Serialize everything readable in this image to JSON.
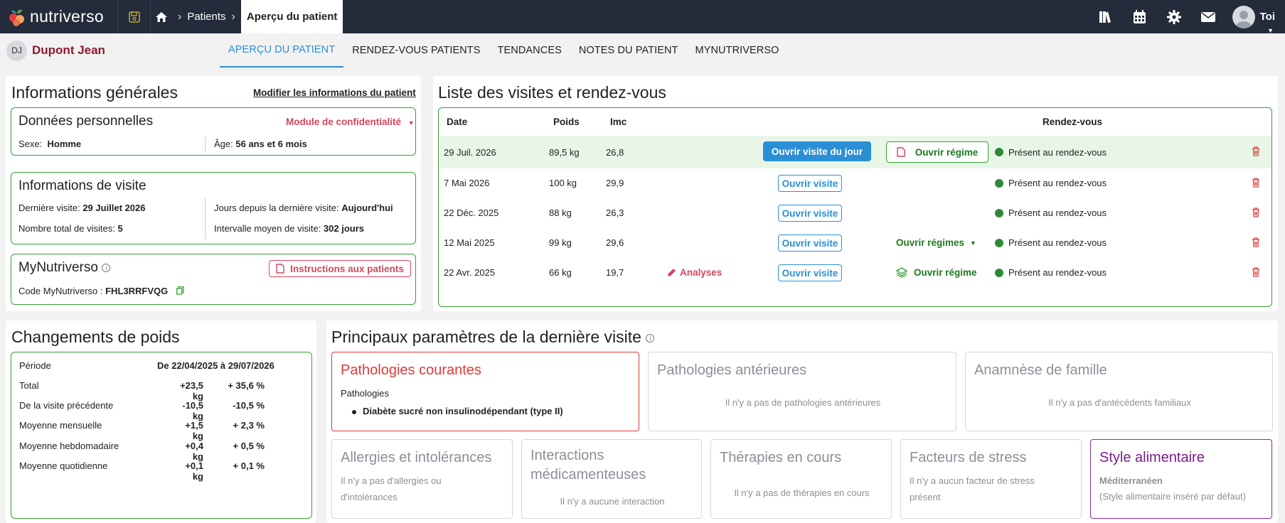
{
  "app": {
    "logo_text": "nutriverso",
    "brand_colors": {
      "topbar": "#242b3a",
      "accent": "#2b8fd5",
      "green": "#34a233",
      "pink": "#d6455e"
    }
  },
  "breadcrumb": {
    "items": [
      "Patients"
    ],
    "current": "Aperçu du patient"
  },
  "top_icons": [
    "library-icon",
    "calendar-icon",
    "gear-icon",
    "mail-icon"
  ],
  "user": {
    "label": "Toi"
  },
  "patient": {
    "initials": "DJ",
    "name": "Dupont Jean"
  },
  "tabs": [
    {
      "label": "APERÇU DU PATIENT",
      "active": true
    },
    {
      "label": "RENDEZ-VOUS PATIENTS"
    },
    {
      "label": "TENDANCES"
    },
    {
      "label": "NOTES DU PATIENT"
    },
    {
      "label": "MYNUTRIVERSO"
    }
  ],
  "general": {
    "title": "Informations générales",
    "edit_link": "Modifier les informations du patient",
    "personal": {
      "title": "Données personnelles",
      "privacy_module": "Module de confidentialité",
      "sex_label": "Sexe:",
      "sex_value": "Homme",
      "age_label": "Âge:",
      "age_value": "56 ans et 6 mois"
    },
    "visit_info": {
      "title": "Informations de visite",
      "last_visit_label": "Dernière visite:",
      "last_visit_value": "29 Juillet 2026",
      "days_since_label": "Jours depuis la dernière visite:",
      "days_since_value": "Aujourd'hui",
      "total_visits_label": "Nombre total de visites:",
      "total_visits_value": "5",
      "avg_interval_label": "Intervalle moyen de visite:",
      "avg_interval_value": "302 jours"
    },
    "mynutriverso": {
      "title": "MyNutriverso",
      "instructions_button": "Instructions aux patients",
      "code_label": "Code MyNutriverso :",
      "code_value": "FHL3RRFVQG"
    }
  },
  "visits": {
    "title": "Liste des visites et rendez-vous",
    "headers": {
      "date": "Date",
      "weight": "Poids",
      "bmi": "Imc",
      "appointment": "Rendez-vous"
    },
    "rows": [
      {
        "date": "29 Juil. 2026",
        "weight": "89,5 kg",
        "bmi": "26,8",
        "analyses": "",
        "visit_button": "Ouvrir visite du jour",
        "diet": "Ouvrir régime",
        "status": "Présent au rendez-vous"
      },
      {
        "date": "7 Mai 2026",
        "weight": "100 kg",
        "bmi": "29,9",
        "analyses": "",
        "visit_button": "Ouvrir visite",
        "diet": "",
        "status": "Présent au rendez-vous"
      },
      {
        "date": "22 Déc. 2025",
        "weight": "88 kg",
        "bmi": "26,3",
        "analyses": "",
        "visit_button": "Ouvrir visite",
        "diet": "",
        "status": "Présent au rendez-vous"
      },
      {
        "date": "12 Mai 2025",
        "weight": "99 kg",
        "bmi": "29,6",
        "analyses": "",
        "visit_button": "Ouvrir visite",
        "diet": "Ouvrir régimes",
        "status": "Présent au rendez-vous"
      },
      {
        "date": "22 Avr. 2025",
        "weight": "66 kg",
        "bmi": "19,7",
        "analyses": "Analyses",
        "visit_button": "Ouvrir visite",
        "diet": "Ouvrir régime",
        "status": "Présent au rendez-vous"
      }
    ]
  },
  "weight": {
    "title": "Changements de poids",
    "period_label": "Période",
    "period_value": "De 22/04/2025 à 29/07/2026",
    "rows": [
      {
        "label": "Total",
        "kg": "+23,5 kg",
        "pct": "+ 35,6 %"
      },
      {
        "label": "De la visite précédente",
        "kg": "-10,5 kg",
        "pct": "-10,5 %"
      },
      {
        "label": "Moyenne mensuelle",
        "kg": "+1,5 kg",
        "pct": "+ 2,3 %"
      },
      {
        "label": "Moyenne hebdomadaire",
        "kg": "+0,4 kg",
        "pct": "+ 0,5 %"
      },
      {
        "label": "Moyenne quotidienne",
        "kg": "+0,1 kg",
        "pct": "+ 0,1 %"
      }
    ]
  },
  "params": {
    "title": "Principaux paramètres de la dernière visite",
    "current_pathologies": {
      "title": "Pathologies courantes",
      "sub": "Pathologies",
      "item": "Diabète sucré non insulinodépendant (type II)"
    },
    "past_pathologies": {
      "title": "Pathologies antérieures",
      "empty": "Il n'y a pas de pathologies antérieures"
    },
    "family_history": {
      "title": "Anamnèse de famille",
      "empty": "Il n'y a pas d'antécédents familiaux"
    },
    "allergies": {
      "title": "Allergies et intolérances",
      "empty_line1": "Il n'y a pas d'allergies ou",
      "empty_line2": "d'intolérances"
    },
    "interactions": {
      "title_line1": "Interactions",
      "title_line2": "médicamenteuses",
      "empty": "Il n'y a aucune interaction"
    },
    "therapies": {
      "title": "Thérapies en cours",
      "empty": "Il n'y a pas de thérapies en cours"
    },
    "stress": {
      "title": "Facteurs de stress",
      "empty_line1": "Il n'y a aucun facteur de stress",
      "empty_line2": "présent"
    },
    "diet_style": {
      "title": "Style alimentaire",
      "value": "Méditerranéen",
      "note": "(Style alimentaire inséré par défaut)"
    }
  }
}
